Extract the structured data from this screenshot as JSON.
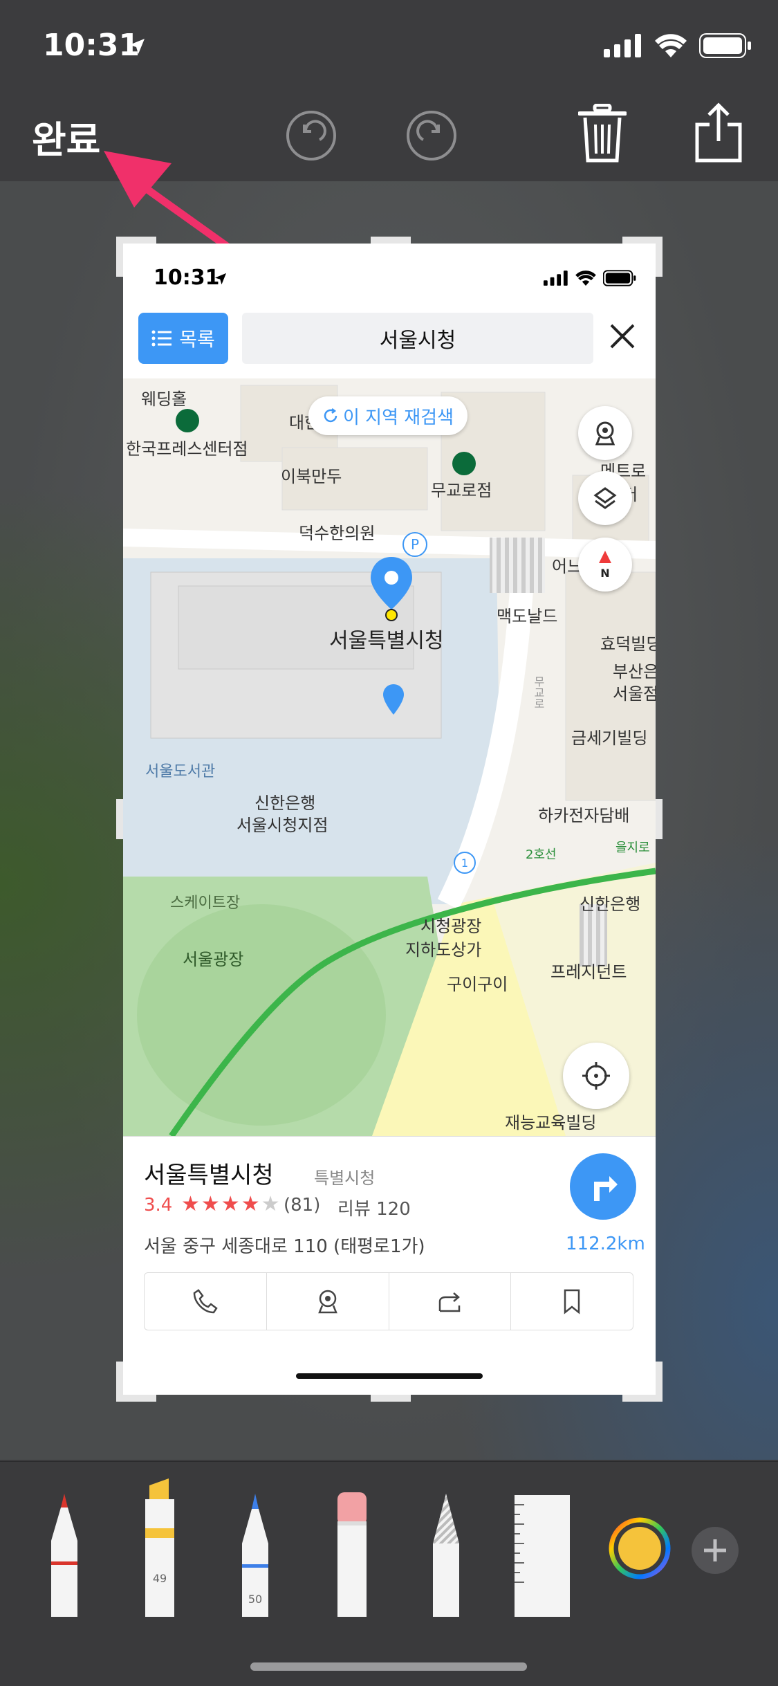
{
  "status_bar": {
    "time": "10:31"
  },
  "toolbar": {
    "done_label": "완료"
  },
  "screenshot": {
    "status_time": "10:31",
    "list_button_label": "목록",
    "search_text": "서울시청",
    "map": {
      "research_button": "이 지역 재검색",
      "labels": {
        "wedding": "웨딩홀",
        "press_center": "한국프레스센터점",
        "daehan": "대한",
        "ibuk": "이북만두",
        "mugyo": "무교로점",
        "metro": "메트로",
        "center": "센터",
        "deoksu": "덕수한의원",
        "eo": "어느",
        "mcd": "맥도날드",
        "hyodeok": "효덕빌딩",
        "busan": "부산은행",
        "seoul_s": "서울점",
        "city_hall": "서울특별시청",
        "geumse": "금세기빌딩",
        "library": "서울도서관",
        "shinhan1": "신한은행",
        "shinhan1b": "서울시청지점",
        "hakka": "하카전자담배",
        "line2": "2호선",
        "euljiro": "을지로",
        "skating": "스케이트장",
        "plaza": "서울광장",
        "shinhan2": "신한은행",
        "underground1": "시청광장",
        "underground2": "지하도상가",
        "guigui": "구이구이",
        "prezident": "프레지던트",
        "jaeneung": "재능교육빌딩",
        "p_mark": "P",
        "exit_num": "1",
        "road": "무교로"
      }
    },
    "place": {
      "name": "서울특별시청",
      "category": "특별시청",
      "rating": "3.4",
      "rating_value": 3.4,
      "rating_count": "(81)",
      "review": "리뷰 120",
      "address": "서울 중구 세종대로 110 (태평로1가)",
      "distance": "112.2km"
    }
  },
  "tools": {
    "highlighter_size": "49",
    "pencil_size": "50"
  },
  "colors": {
    "accent": "#3d97f5",
    "annotation": "#f0306a",
    "line2": "#3cb54a"
  }
}
